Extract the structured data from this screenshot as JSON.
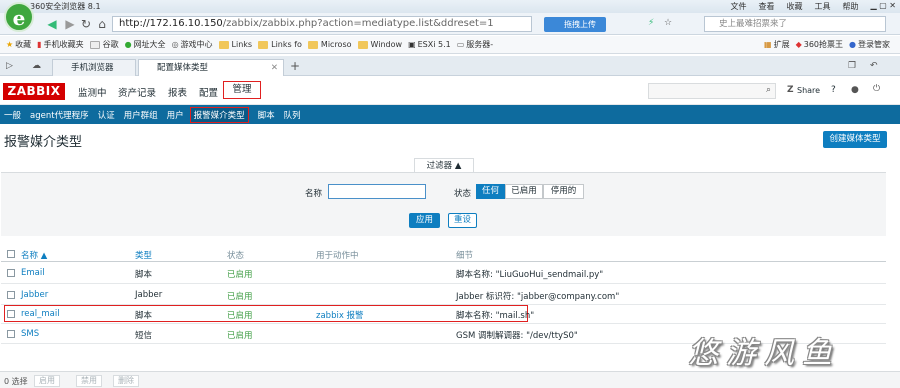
{
  "browser": {
    "title": "360安全浏览器 8.1",
    "menus": [
      "文件",
      "查看",
      "收藏",
      "工具",
      "帮助"
    ],
    "url_host": "http://172.16.10.150",
    "url_path": "/zabbix/zabbix.php?action=mediatype.list&ddreset=1",
    "upload_label": "拖拽上传",
    "search_placeholder": "史上最难招票来了",
    "bookmarks": [
      "收藏",
      "手机收藏夹",
      "谷歌",
      "网址大全",
      "游戏中心",
      "Links",
      "Links fo",
      "Microso",
      "Window",
      "ESXi 5.1",
      "服务器-"
    ],
    "bookmarks_right": [
      "扩展",
      "360抢票王",
      "登录管家"
    ],
    "tabs": [
      "手机浏览器",
      "配置媒体类型"
    ],
    "new_tab": "+"
  },
  "zabbix": {
    "logo": "ZABBIX",
    "top_menu": [
      "监测中",
      "资产记录",
      "报表",
      "配置",
      "管理"
    ],
    "share_label": "Share",
    "help": "?",
    "sub_menu": [
      "一般",
      "agent代理程序",
      "认证",
      "用户群组",
      "用户",
      "报警媒介类型",
      "脚本",
      "队列"
    ],
    "page_title": "报警媒介类型",
    "create_button": "创建媒体类型",
    "filter": {
      "tab_label": "过滤器 ▲",
      "name_label": "名称",
      "status_label": "状态",
      "status_options": [
        "任何",
        "已启用",
        "停用的"
      ],
      "apply": "应用",
      "reset": "重设"
    },
    "table": {
      "headers": [
        "名称 ▲",
        "类型",
        "状态",
        "用于动作中",
        "细节"
      ],
      "rows": [
        {
          "name": "Email",
          "type": "脚本",
          "status": "已启用",
          "action": "",
          "details": "脚本名称: \"LiuGuoHui_sendmail.py\""
        },
        {
          "name": "Jabber",
          "type": "Jabber",
          "status": "已启用",
          "action": "",
          "details": "Jabber 标识符: \"jabber@company.com\""
        },
        {
          "name": "real_mail",
          "type": "脚本",
          "status": "已启用",
          "action": "zabbix 报警",
          "details": "脚本名称: \"mail.sh\""
        },
        {
          "name": "SMS",
          "type": "短信",
          "status": "已启用",
          "action": "",
          "details": "GSM 调制解调器: \"/dev/ttyS0\""
        }
      ]
    },
    "footer": {
      "selected": "0 选择",
      "buttons": [
        "启用",
        "禁用",
        "删除"
      ]
    }
  },
  "watermark": "悠游风鱼"
}
